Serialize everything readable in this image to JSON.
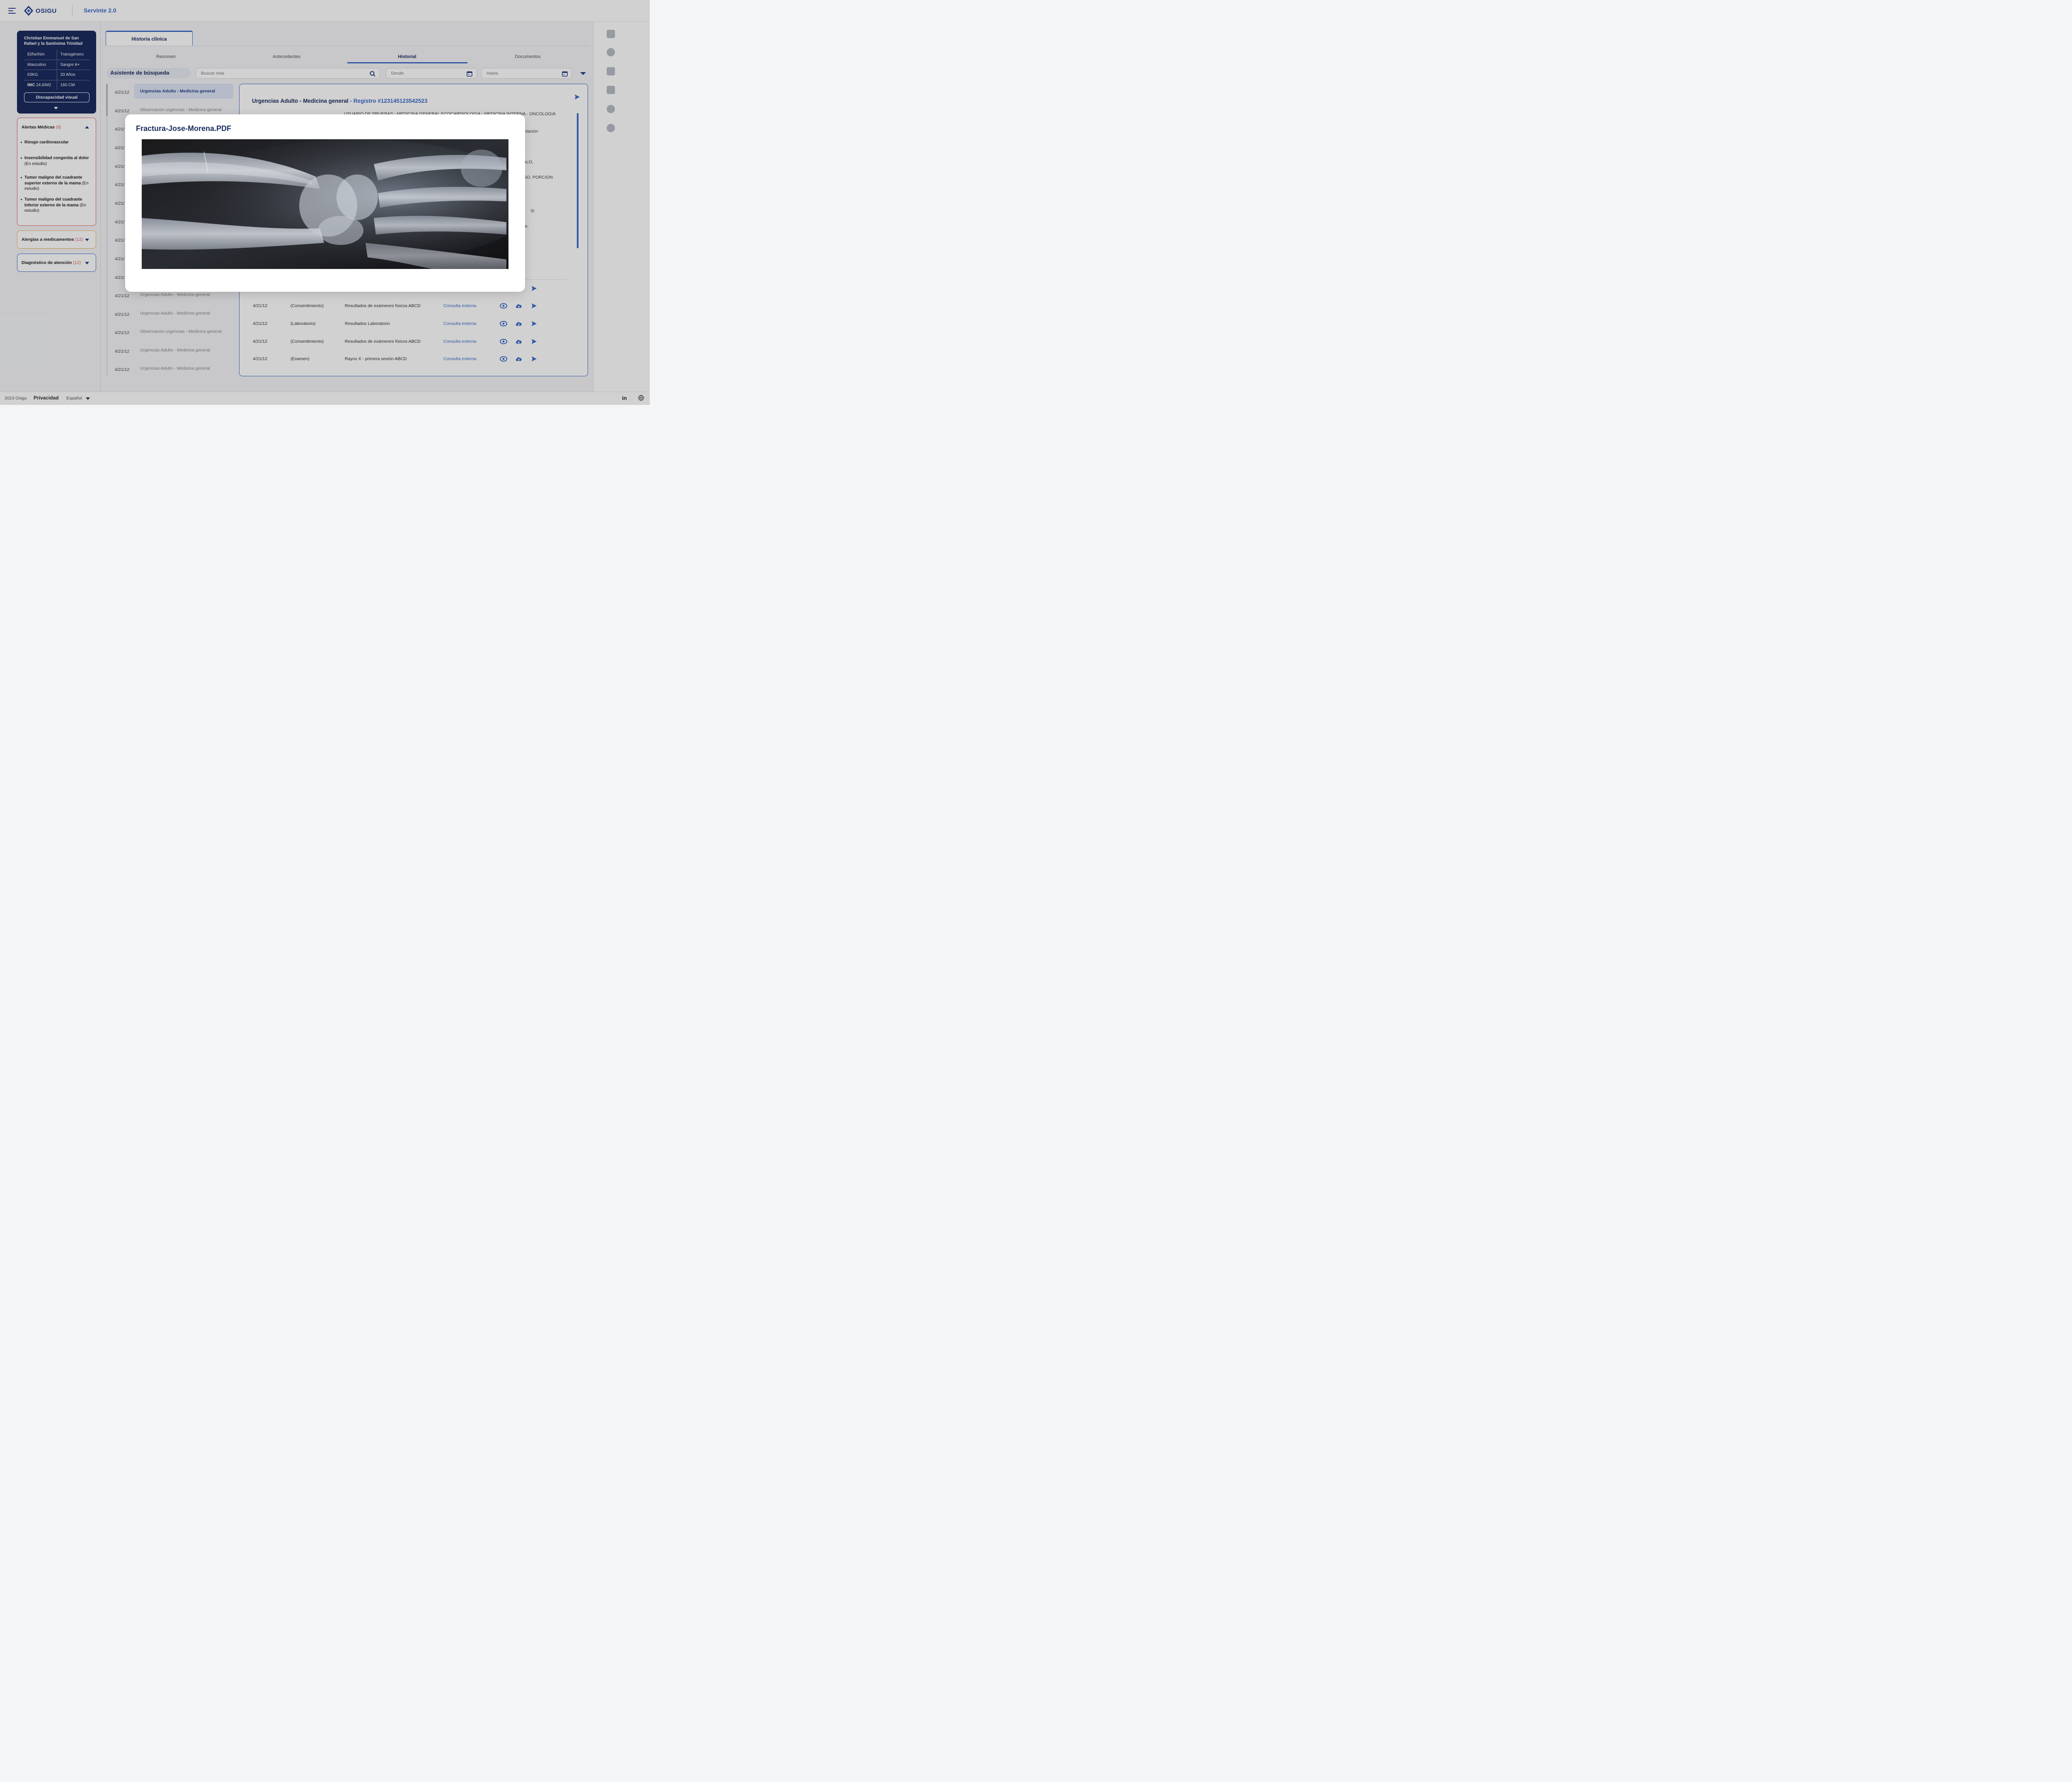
{
  "header": {
    "logo_text": "OSIGU",
    "app_title": "Servinte 2.0"
  },
  "patient": {
    "name": "Christian Emmanuel de San Rafael y la Santísima Trinidad",
    "rows": [
      {
        "left": "El/he/him",
        "right": "Transgénero"
      },
      {
        "left": "Masculino",
        "right": "Sangre A+"
      },
      {
        "left": "63KG",
        "right": "33 Años"
      },
      {
        "left_label": "IMC",
        "left": "24.6/M2",
        "right": "160 CM"
      }
    ],
    "disability_button": "Discapacidad visual"
  },
  "alerts": {
    "title": "Alertas Médicas",
    "count": "(8)",
    "items": [
      {
        "bold": "Riesgo cardiovascular",
        "note": ""
      },
      {
        "bold": "Insensibilidad congenita al dolor",
        "note": "(En estudio)"
      },
      {
        "bold": "Tumor maligno del cuadrante superior externo de la mama",
        "note": "(En estudio)"
      },
      {
        "bold": "Tumor maligno del cuadrante Inferior externo de la mama",
        "note": "(En estudio)"
      }
    ]
  },
  "allergies": {
    "title": "Alergías a medicamentos",
    "count": "(12)"
  },
  "diagnosis": {
    "title": "Diagnóstico de atención",
    "count": "(12)"
  },
  "main_tab": "Historia clínica",
  "subtabs": [
    "Resumen",
    "Antecedentes",
    "Historial",
    "Documentos"
  ],
  "search": {
    "assistant_label": "Asistente de búsqueda",
    "note_placeholder": "Buscar nota",
    "from_placeholder": "Desde",
    "to_placeholder": "Hasta"
  },
  "history_list": [
    {
      "date": "4/21/12",
      "name": "Urgencias Adulto - Medicina general"
    },
    {
      "date": "4/21/12",
      "name": "Observación urgencias - Medicina general"
    },
    {
      "date": "4/21/",
      "name": ""
    },
    {
      "date": "4/21/",
      "name": ""
    },
    {
      "date": "4/21/",
      "name": ""
    },
    {
      "date": "4/21/",
      "name": ""
    },
    {
      "date": "4/21/",
      "name": ""
    },
    {
      "date": "4/21/",
      "name": ""
    },
    {
      "date": "4/21/",
      "name": ""
    },
    {
      "date": "4/21/",
      "name": ""
    },
    {
      "date": "4/21/",
      "name": ""
    },
    {
      "date": "4/21/12",
      "name": "Urgencias Adulto - Medicina general"
    },
    {
      "date": "4/21/12",
      "name": "Urgencias Adulto - Medicina general"
    },
    {
      "date": "4/21/12",
      "name": "Observación urgencias - Medicina general"
    },
    {
      "date": "4/21/12",
      "name": "Urgencias Adulto - Medicina general"
    },
    {
      "date": "4/21/12",
      "name": "Urgencias Adulto - Medicina general"
    }
  ],
  "detail": {
    "title": "Urgencias Adulto - Medicina general",
    "registro": "- Registro #123145123542523",
    "bg_fragments": [
      "USUARIO DE PRUEBAS - MEDICINA GENERAL ECOCARDIOLOGIA - MEDICINA INTERNA - ONCOLOGIA",
      "mentación",
      "EFALO,",
      "FAGO. PORCION",
      "Si",
      "iente."
    ],
    "documents": [
      {
        "date": "4/21/12",
        "type": "(Consentimiento)",
        "desc": "Resultados de exámenes físicos ABCD",
        "link": "Consulta externa"
      },
      {
        "date": "4/21/12",
        "type": "(Laboratorio)",
        "desc": "Resultados Laboratorio",
        "link": "Consulta externa"
      },
      {
        "date": "4/21/12",
        "type": "(Consentimiento)",
        "desc": "Resultados de exámenes físicos ABCD",
        "link": "Consulta externa"
      },
      {
        "date": "4/21/12",
        "type": "(Examen)",
        "desc": "Rayos X - primera sesión ABCD",
        "link": "Consulta externa"
      }
    ]
  },
  "modal": {
    "title": "Fractura-Jose-Morena.PDF",
    "image_icon": "xray-image"
  },
  "footer": {
    "copyright": "2023 Osigu",
    "privacy": "Privacidad",
    "language": "Español",
    "social": "in"
  },
  "colors": {
    "primary": "#1b2b5e",
    "accent": "#3d6bc9",
    "alert": "#e05c5c",
    "allergy": "#f0b24e"
  }
}
